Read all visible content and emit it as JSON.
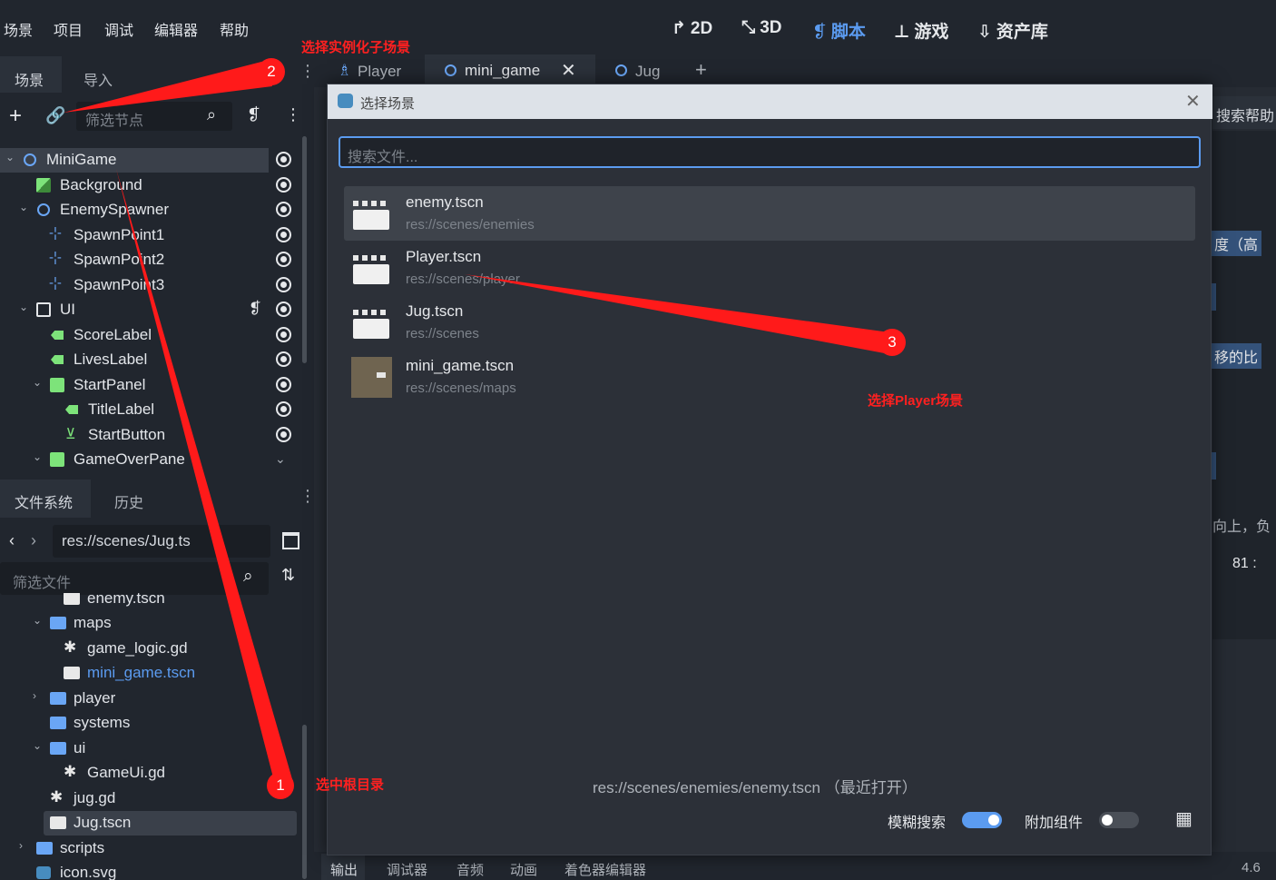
{
  "menu": [
    "场景",
    "项目",
    "调试",
    "编辑器",
    "帮助"
  ],
  "modes": [
    {
      "label": "2D",
      "icon": "2d-transform-icon",
      "active": false
    },
    {
      "label": "3D",
      "icon": "3d-transform-icon",
      "active": false
    },
    {
      "label": "脚本",
      "icon": "script-icon",
      "active": true
    },
    {
      "label": "游戏",
      "icon": "game-icon",
      "active": false
    },
    {
      "label": "资产库",
      "icon": "asset-library-icon",
      "active": false
    }
  ],
  "scene_dock": {
    "tabs": [
      "场景",
      "导入"
    ],
    "filter_placeholder": "筛选节点",
    "nodes": [
      {
        "label": "MiniGame",
        "depth": 0,
        "icon": "node2d-icon",
        "selected": true,
        "expanded": true
      },
      {
        "label": "Background",
        "depth": 1,
        "icon": "texture-rect-icon"
      },
      {
        "label": "EnemySpawner",
        "depth": 1,
        "icon": "node2d-icon",
        "expanded": true
      },
      {
        "label": "SpawnPoint1",
        "depth": 2,
        "icon": "marker2d-icon"
      },
      {
        "label": "SpawnPoint2",
        "depth": 2,
        "icon": "marker2d-icon"
      },
      {
        "label": "SpawnPoint3",
        "depth": 2,
        "icon": "marker2d-icon"
      },
      {
        "label": "UI",
        "depth": 1,
        "icon": "canvas-layer-icon",
        "expanded": true,
        "script": true
      },
      {
        "label": "ScoreLabel",
        "depth": 2,
        "icon": "label-icon"
      },
      {
        "label": "LivesLabel",
        "depth": 2,
        "icon": "label-icon"
      },
      {
        "label": "StartPanel",
        "depth": 2,
        "icon": "panel-icon",
        "expanded": true
      },
      {
        "label": "TitleLabel",
        "depth": 3,
        "icon": "label-icon"
      },
      {
        "label": "StartButton",
        "depth": 3,
        "icon": "button-icon"
      },
      {
        "label": "GameOverPane",
        "depth": 2,
        "icon": "panel-icon",
        "expanded": true
      }
    ]
  },
  "filesystem": {
    "tabs": [
      "文件系统",
      "历史"
    ],
    "path": "res://scenes/Jug.ts",
    "filter_placeholder": "筛选文件",
    "items": [
      {
        "label": "enemy.tscn",
        "depth": 3,
        "type": "scene"
      },
      {
        "label": "maps",
        "depth": 2,
        "type": "folder",
        "expanded": true
      },
      {
        "label": "game_logic.gd",
        "depth": 3,
        "type": "script"
      },
      {
        "label": "mini_game.tscn",
        "depth": 3,
        "type": "scene",
        "highlight": true
      },
      {
        "label": "player",
        "depth": 2,
        "type": "folder",
        "collapsed": true
      },
      {
        "label": "systems",
        "depth": 2,
        "type": "folder"
      },
      {
        "label": "ui",
        "depth": 2,
        "type": "folder",
        "expanded": true
      },
      {
        "label": "GameUi.gd",
        "depth": 3,
        "type": "script"
      },
      {
        "label": "jug.gd",
        "depth": 2,
        "type": "script"
      },
      {
        "label": "Jug.tscn",
        "depth": 2,
        "type": "scene",
        "selected": true
      },
      {
        "label": "scripts",
        "depth": 1,
        "type": "folder",
        "collapsed": true
      },
      {
        "label": "icon.svg",
        "depth": 1,
        "type": "image"
      }
    ]
  },
  "editor_tabs": [
    {
      "label": "Player",
      "icon": "player-icon"
    },
    {
      "label": "mini_game",
      "icon": "node2d-icon",
      "active": true
    },
    {
      "label": "Jug",
      "icon": "node2d-icon"
    }
  ],
  "right_fragments": {
    "search_help": "搜索帮助",
    "frag1": "度（高",
    "frag2": "移的比",
    "frag3": "向上，负",
    "frag4": "81 :"
  },
  "bottom_tabs": [
    "输出",
    "调试器",
    "音频",
    "动画",
    "着色器编辑器"
  ],
  "version": "4.6",
  "dialog": {
    "title": "选择场景",
    "search_placeholder": "搜索文件...",
    "results": [
      {
        "name": "enemy.tscn",
        "path": "res://scenes/enemies",
        "selected": true
      },
      {
        "name": "Player.tscn",
        "path": "res://scenes/player"
      },
      {
        "name": "Jug.tscn",
        "path": "res://scenes"
      },
      {
        "name": "mini_game.tscn",
        "path": "res://scenes/maps",
        "thumb": "image"
      }
    ],
    "footer_path": "res://scenes/enemies/enemy.tscn （最近打开）",
    "fuzzy_label": "模糊搜索",
    "fuzzy_on": true,
    "addon_label": "附加组件",
    "addon_on": false
  },
  "annotations": {
    "a1_text": "选中根目录",
    "a1_num": "1",
    "a2_text": "选择实例化子场景",
    "a2_num": "2",
    "a3_text": "选择Player场景",
    "a3_num": "3"
  }
}
